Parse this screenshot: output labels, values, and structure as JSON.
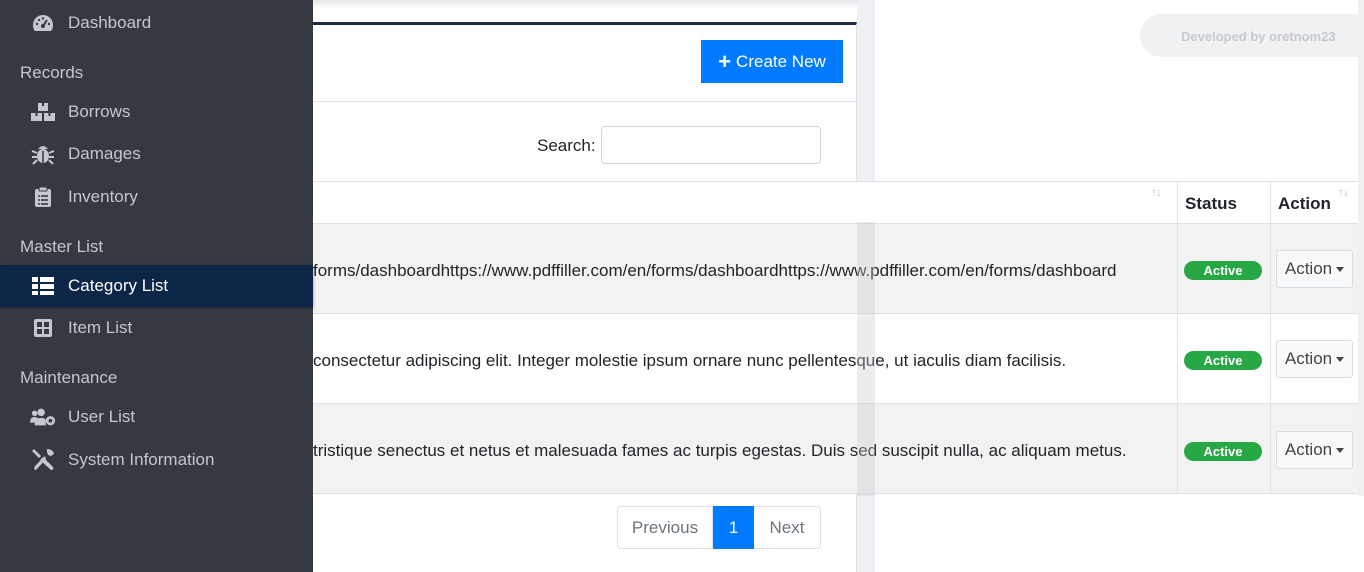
{
  "sidebar": {
    "dashboard": "Dashboard",
    "records_header": "Records",
    "borrows": "Borrows",
    "damages": "Damages",
    "inventory": "Inventory",
    "master_header": "Master List",
    "category_list": "Category List",
    "item_list": "Item List",
    "maintenance_header": "Maintenance",
    "user_list": "User List",
    "system_information": "System Information"
  },
  "header": {
    "create_button": "Create New",
    "developer_credit": "Developed by oretnom23"
  },
  "search": {
    "label": "Search:",
    "value": ""
  },
  "table": {
    "columns": [
      "Status",
      "Action"
    ],
    "sort_icon": "↑↓",
    "rows": [
      {
        "description": "forms/dashboardhttps://www.pdffiller.com/en/forms/dashboardhttps://www.pdffiller.com/en/forms/dashboard",
        "status": "Active",
        "action": "Action"
      },
      {
        "description": "consectetur adipiscing elit. Integer molestie ipsum ornare nunc pellentesque, ut iaculis diam facilisis.",
        "status": "Active",
        "action": "Action"
      },
      {
        "description": "tristique senectus et netus et malesuada fames ac turpis egestas. Duis sed suscipit nulla, ac aliquam metus.",
        "status": "Active",
        "action": "Action"
      }
    ]
  },
  "pagination": {
    "previous": "Previous",
    "current": "1",
    "next": "Next"
  },
  "colors": {
    "primary": "#007bff",
    "success": "#28a745",
    "sidebar_bg": "#343a40",
    "sidebar_active": "#0c2647"
  }
}
